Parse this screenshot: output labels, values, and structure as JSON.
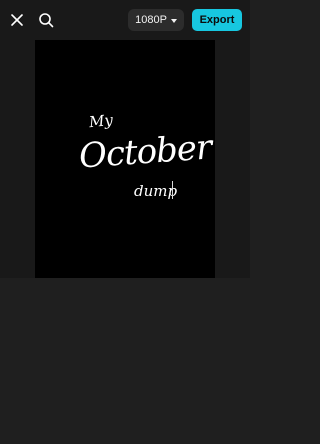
{
  "toolbar": {
    "close_icon": "close-icon",
    "search_icon": "search-icon",
    "resolution_label": "1080P",
    "resolution_icon": "caret-down-icon",
    "export_label": "Export",
    "export_color": "#17c7e0"
  },
  "canvas": {
    "background": "#000000",
    "text_line_1": "My",
    "text_line_2": "October",
    "text_line_3": "dump"
  }
}
